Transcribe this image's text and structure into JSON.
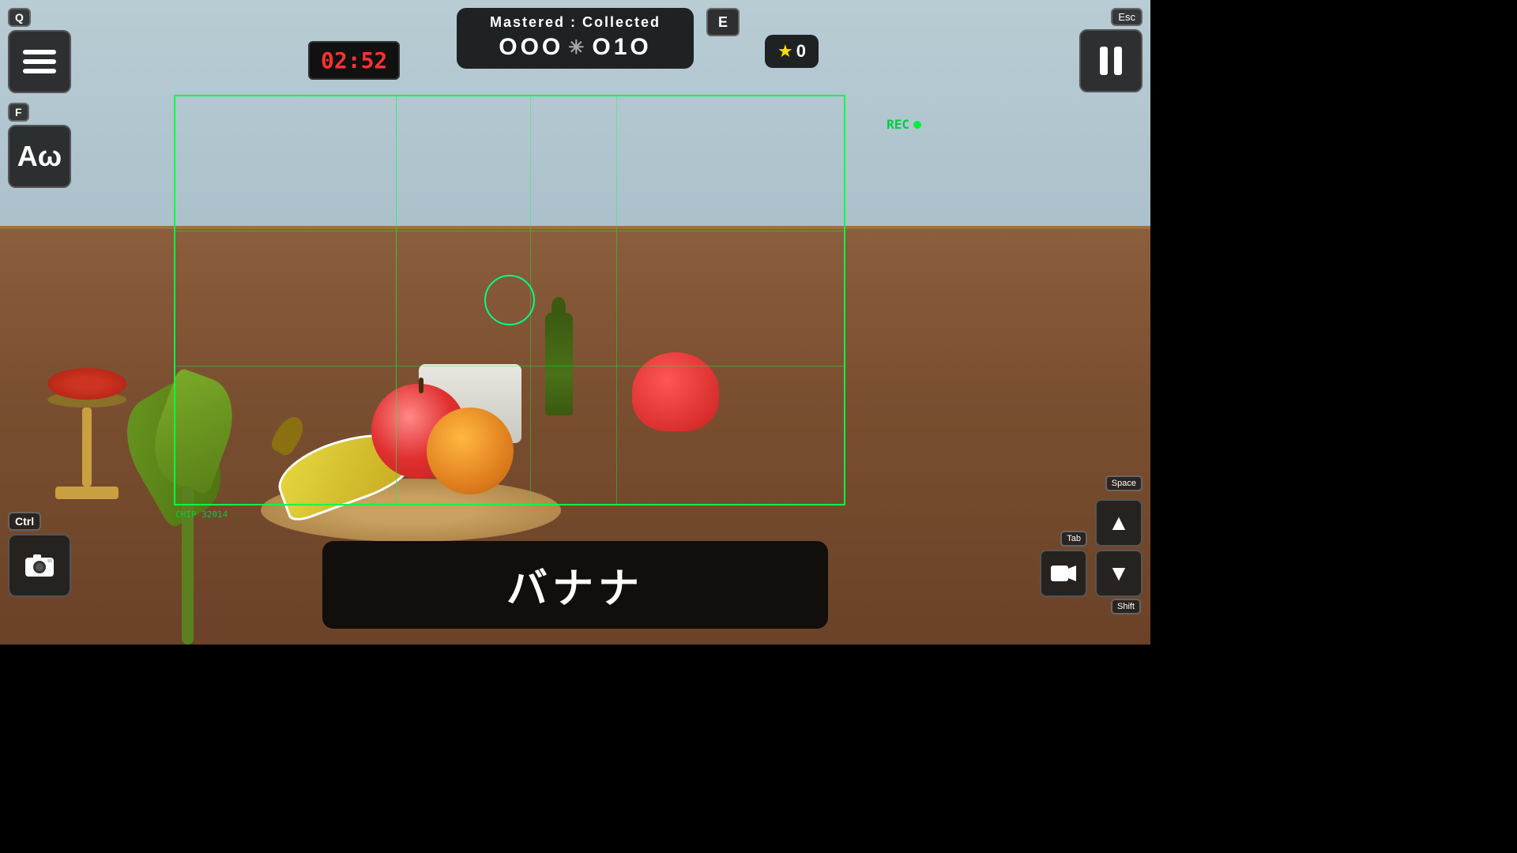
{
  "game": {
    "title": "Mastered : Collected",
    "mastered": "OOO",
    "divider": "✳",
    "collected": "O1O",
    "timer": "02:52",
    "stars": "0",
    "chip_id": "CHIP 32014",
    "item_name": "バナナ",
    "rec_label": "REC"
  },
  "keys": {
    "q": "Q",
    "f": "F",
    "e": "E",
    "ctrl": "Ctrl",
    "esc": "Esc",
    "space": "Space",
    "shift": "Shift",
    "tab": "Tab"
  },
  "icons": {
    "menu": "menu-icon",
    "font": "font-icon",
    "camera": "camera-icon",
    "pause": "pause-icon",
    "arrow_up": "▲",
    "arrow_down": "▼",
    "star": "★",
    "video_camera": "video-camera-icon"
  }
}
